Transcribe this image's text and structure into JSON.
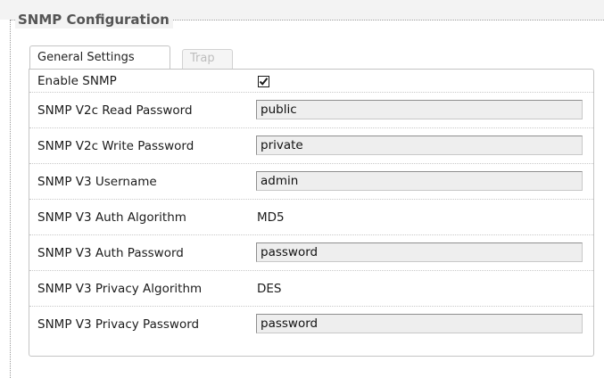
{
  "section": {
    "title": "SNMP Configuration"
  },
  "tabs": [
    {
      "label": "General Settings",
      "active": true
    },
    {
      "label": "Trap",
      "active": false
    }
  ],
  "settings": {
    "enable_snmp": {
      "label": "Enable SNMP",
      "checked": true
    },
    "v2c_read_password": {
      "label": "SNMP V2c Read Password",
      "value": "public"
    },
    "v2c_write_password": {
      "label": "SNMP V2c Write Password",
      "value": "private"
    },
    "v3_username": {
      "label": "SNMP V3 Username",
      "value": "admin"
    },
    "v3_auth_algorithm": {
      "label": "SNMP V3 Auth Algorithm",
      "value": "MD5"
    },
    "v3_auth_password": {
      "label": "SNMP V3 Auth Password",
      "value": "password"
    },
    "v3_privacy_algorithm": {
      "label": "SNMP V3 Privacy Algorithm",
      "value": "DES"
    },
    "v3_privacy_password": {
      "label": "SNMP V3 Privacy Password",
      "value": "password"
    }
  },
  "colors": {
    "panel_border": "#c4c4c4",
    "input_background": "#eeeeee",
    "disabled_tab_text": "#bdbdbd",
    "legend_text": "#555555"
  }
}
